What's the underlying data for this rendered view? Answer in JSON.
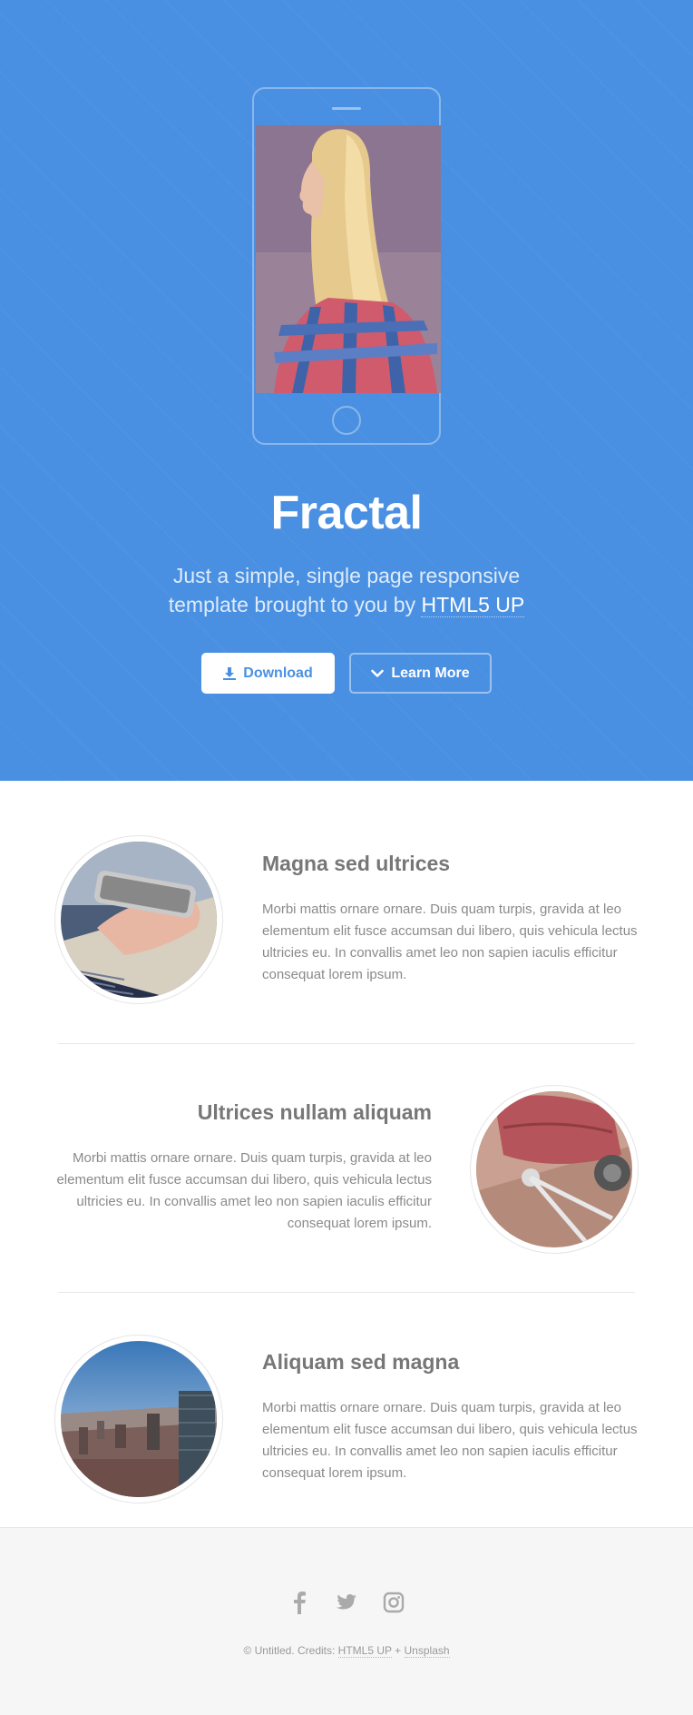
{
  "colors": {
    "accent": "#4a90e2",
    "footer_bg": "#f6f6f6"
  },
  "header": {
    "title": "Fractal",
    "subtitle_line1": "Just a simple, single page responsive",
    "subtitle_line2": "template brought to you by",
    "subtitle_link": "HTML5 UP",
    "buttons": {
      "download": {
        "label": "Download",
        "icon": "download-icon"
      },
      "learn_more": {
        "label": "Learn More",
        "icon": "chevron-down-icon"
      }
    }
  },
  "features": [
    {
      "title": "Magna sed ultrices",
      "text": "Morbi mattis ornare ornare. Duis quam turpis, gravida at leo elementum elit fusce accumsan dui libero, quis vehicula lectus ultricies eu. In convallis amet leo non sapien iaculis efficitur consequat lorem ipsum."
    },
    {
      "title": "Ultrices nullam aliquam",
      "text": "Morbi mattis ornare ornare. Duis quam turpis, gravida at leo elementum elit fusce accumsan dui libero, quis vehicula lectus ultricies eu. In convallis amet leo non sapien iaculis efficitur consequat lorem ipsum."
    },
    {
      "title": "Aliquam sed magna",
      "text": "Morbi mattis ornare ornare. Duis quam turpis, gravida at leo elementum elit fusce accumsan dui libero, quis vehicula lectus ultricies eu. In convallis amet leo non sapien iaculis efficitur consequat lorem ipsum."
    }
  ],
  "footer": {
    "social_icons": [
      "facebook-icon",
      "twitter-icon",
      "instagram-icon"
    ],
    "copyright_prefix": "© Untitled. Credits:",
    "credit_html5up": "HTML5 UP",
    "credit_separator": "+",
    "credit_unsplash": "Unsplash"
  }
}
